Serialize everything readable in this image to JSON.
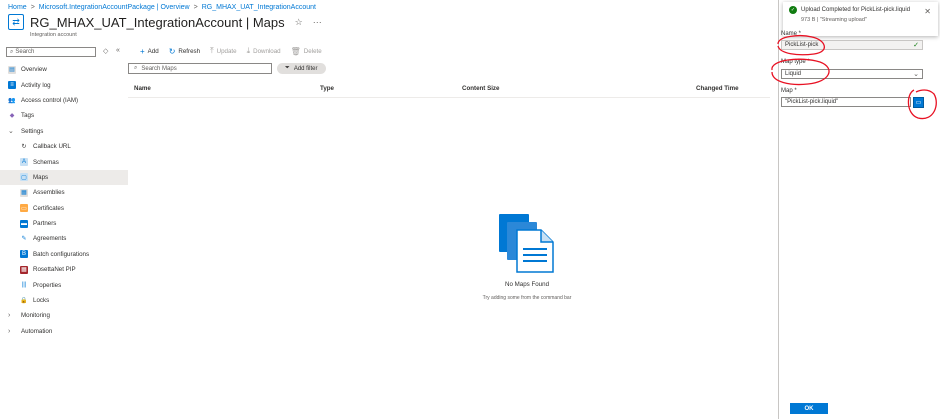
{
  "breadcrumb": {
    "items": [
      "Home",
      "Microsoft.IntegrationAccountPackage | Overview",
      "RG_MHAX_UAT_IntegrationAccount"
    ],
    "sep": ">"
  },
  "header": {
    "title": "RG_MHAX_UAT_IntegrationAccount",
    "section": "Maps",
    "subtitle": "Integration account",
    "star": "☆",
    "more": "···"
  },
  "sidebar": {
    "search_placeholder": "Search",
    "items": [
      {
        "label": "Overview",
        "icon": "overview-icon"
      },
      {
        "label": "Activity log",
        "icon": "activity-log-icon"
      },
      {
        "label": "Access control (IAM)",
        "icon": "iam-icon"
      },
      {
        "label": "Tags",
        "icon": "tag-icon"
      },
      {
        "label": "Settings",
        "icon": "chevron-down-icon"
      },
      {
        "label": "Callback URL",
        "icon": "callback-icon"
      },
      {
        "label": "Schemas",
        "icon": "schema-icon"
      },
      {
        "label": "Maps",
        "icon": "map-icon"
      },
      {
        "label": "Assemblies",
        "icon": "assembly-icon"
      },
      {
        "label": "Certificates",
        "icon": "certificate-icon"
      },
      {
        "label": "Partners",
        "icon": "partner-icon"
      },
      {
        "label": "Agreements",
        "icon": "agreement-icon"
      },
      {
        "label": "Batch configurations",
        "icon": "batch-icon"
      },
      {
        "label": "RosettaNet PIP",
        "icon": "rosettanet-icon"
      },
      {
        "label": "Properties",
        "icon": "properties-icon"
      },
      {
        "label": "Locks",
        "icon": "lock-icon"
      },
      {
        "label": "Monitoring",
        "icon": "chevron-right-icon"
      },
      {
        "label": "Automation",
        "icon": "chevron-right-icon"
      }
    ]
  },
  "toolbar": {
    "add": "Add",
    "refresh": "Refresh",
    "update": "Update",
    "download": "Download",
    "delete": "Delete"
  },
  "list": {
    "search_placeholder": "Search Maps",
    "filter_label": "Add filter",
    "columns": [
      "Name",
      "Type",
      "Content Size",
      "Changed Time"
    ],
    "empty_title": "No Maps Found",
    "empty_subtitle": "Try adding some from the command bar"
  },
  "toast": {
    "title": "Upload Completed for PickList-pick.liquid",
    "detail": "973 B | \"Streaming upload\"",
    "close": "✕"
  },
  "form": {
    "name_label": "Name *",
    "name_value": "PickList-pick",
    "map_type_label": "Map type *",
    "map_type_value": "Liquid",
    "map_label": "Map *",
    "map_value": "\"PickList-pick.liquid\"",
    "ok_label": "OK"
  },
  "colors": {
    "accent": "#0078d4",
    "annotation": "#e81123"
  }
}
